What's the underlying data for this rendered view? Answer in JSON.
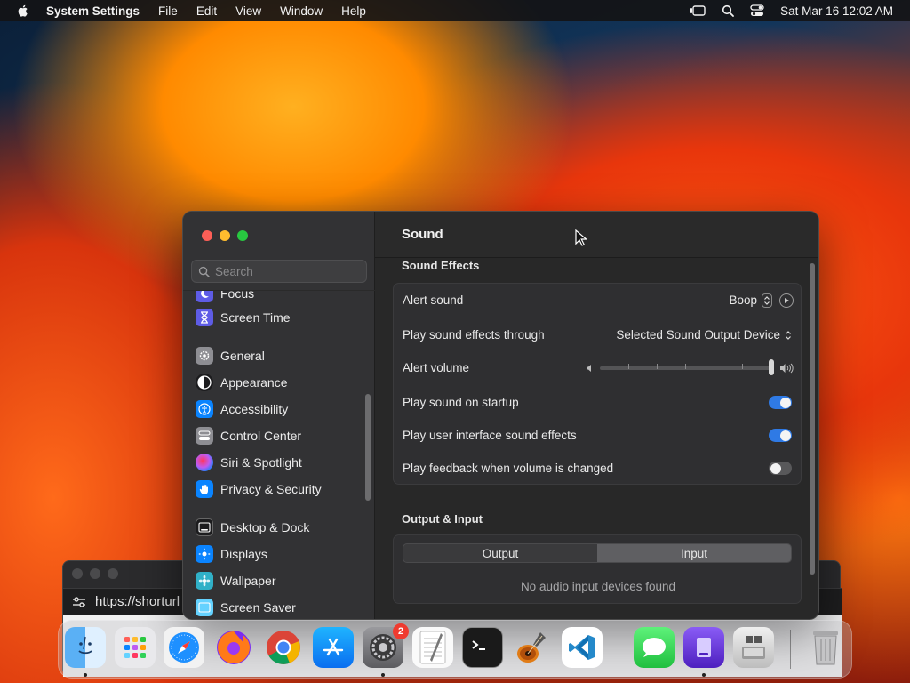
{
  "menubar": {
    "app_name": "System Settings",
    "menus": [
      "File",
      "Edit",
      "View",
      "Window",
      "Help"
    ],
    "datetime": "Sat Mar 16  12:02 AM"
  },
  "background_window": {
    "url": "https://shorturl"
  },
  "window": {
    "search_placeholder": "Search",
    "sidebar": {
      "items": [
        {
          "label": "Focus",
          "icon": "moon-icon",
          "color": "#5e5ce6"
        },
        {
          "label": "Screen Time",
          "icon": "hourglass-icon",
          "color": "#5e5ce6"
        },
        {
          "label": "General",
          "icon": "gear-icon",
          "color": "#8e8e93"
        },
        {
          "label": "Appearance",
          "icon": "appearance-icon",
          "color": "#1c1c1e"
        },
        {
          "label": "Accessibility",
          "icon": "accessibility-icon",
          "color": "#0a84ff"
        },
        {
          "label": "Control Center",
          "icon": "control-center-icon",
          "color": "#8e8e93"
        },
        {
          "label": "Siri & Spotlight",
          "icon": "siri-icon",
          "color": "#bf5af2"
        },
        {
          "label": "Privacy & Security",
          "icon": "hand-icon",
          "color": "#0a84ff"
        },
        {
          "label": "Desktop & Dock",
          "icon": "desktop-icon",
          "color": "#1c1c1e"
        },
        {
          "label": "Displays",
          "icon": "displays-icon",
          "color": "#0a84ff"
        },
        {
          "label": "Wallpaper",
          "icon": "wallpaper-icon",
          "color": "#30b0c7"
        },
        {
          "label": "Screen Saver",
          "icon": "screen-saver-icon",
          "color": "#64d2ff"
        }
      ]
    },
    "content": {
      "title": "Sound",
      "sound_effects": {
        "heading": "Sound Effects",
        "alert_sound_label": "Alert sound",
        "alert_sound_value": "Boop",
        "output_through_label": "Play sound effects through",
        "output_through_value": "Selected Sound Output Device",
        "alert_volume_label": "Alert volume",
        "alert_volume_level": 1.0,
        "startup_label": "Play sound on startup",
        "startup_on": true,
        "ui_effects_label": "Play user interface sound effects",
        "ui_effects_on": true,
        "feedback_label": "Play feedback when volume is changed",
        "feedback_on": false
      },
      "output_input": {
        "heading": "Output & Input",
        "tabs": [
          "Output",
          "Input"
        ],
        "selected_tab": "Input",
        "empty_message": "No audio input devices found"
      }
    }
  },
  "dock": {
    "apps": [
      {
        "name": "Finder",
        "icon": "finder-icon",
        "running": true
      },
      {
        "name": "Launchpad",
        "icon": "launchpad-icon",
        "running": false
      },
      {
        "name": "Safari",
        "icon": "safari-icon",
        "running": false
      },
      {
        "name": "Firefox",
        "icon": "firefox-icon",
        "running": false
      },
      {
        "name": "Chrome",
        "icon": "chrome-icon",
        "running": false
      },
      {
        "name": "App Store",
        "icon": "app-store-icon",
        "running": false
      },
      {
        "name": "System Settings",
        "icon": "system-settings-icon",
        "running": true,
        "badge": "2"
      },
      {
        "name": "TextEdit",
        "icon": "textedit-icon",
        "running": false
      },
      {
        "name": "Terminal",
        "icon": "terminal-icon",
        "running": false
      },
      {
        "name": "GarageBand",
        "icon": "garageband-icon",
        "running": false
      },
      {
        "name": "VS Code",
        "icon": "vscode-icon",
        "running": false
      },
      {
        "name": "Messages",
        "icon": "messages-icon",
        "running": false
      },
      {
        "name": "Apple Configurator",
        "icon": "configurator-icon",
        "running": true
      },
      {
        "name": "Boot Camp",
        "icon": "bootcamp-icon",
        "running": false
      },
      {
        "name": "Trash",
        "icon": "trash-icon",
        "running": false
      }
    ]
  }
}
